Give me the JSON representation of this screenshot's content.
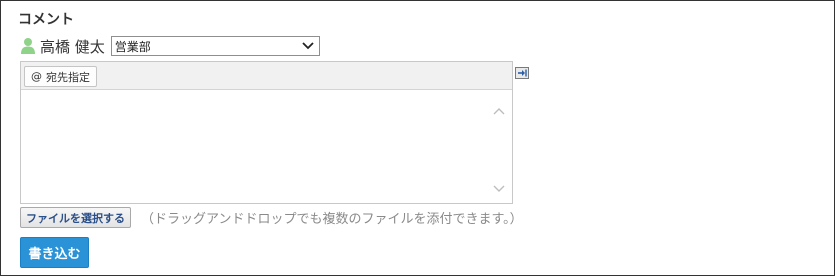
{
  "section": {
    "title": "コメント"
  },
  "user": {
    "name": "高橋 健太",
    "icon": "user-icon"
  },
  "department_select": {
    "selected": "営業部",
    "icon": "chevron-down-icon"
  },
  "editor": {
    "mention_button": {
      "symbol": "@",
      "label": "宛先指定"
    },
    "content": ""
  },
  "attachments": {
    "button_label": "ファイルを選択する",
    "hint": "（ドラッグアンドドロップでも複数のファイルを添付できます。）"
  },
  "submit": {
    "label": "書き込む"
  },
  "colors": {
    "user_icon": "#8fd28a",
    "submit_bg": "#2a92d6",
    "file_button_text": "#2b4f8a",
    "hint_text": "#8a8a8a"
  }
}
